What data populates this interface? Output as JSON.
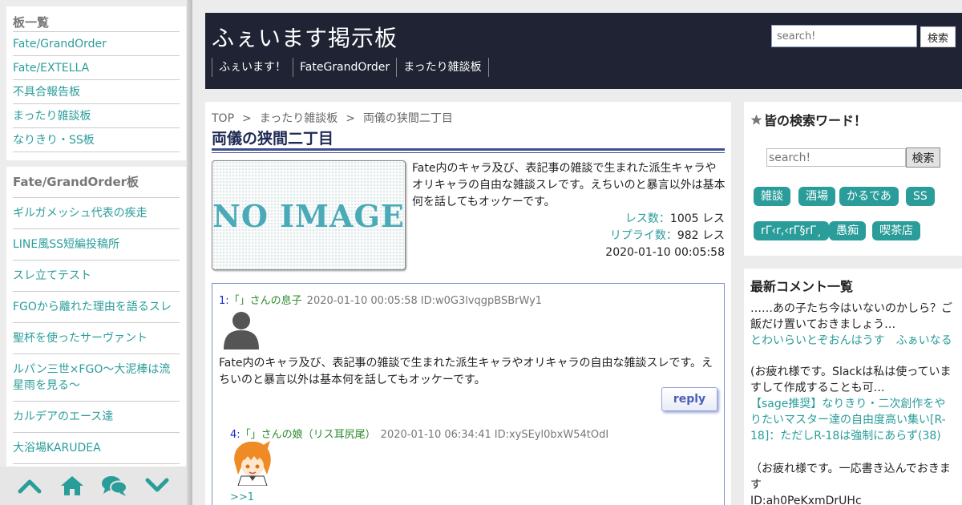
{
  "left_sidebar": {
    "boards_title": "板一覧",
    "boards": [
      "Fate/GrandOrder",
      "Fate/EXTELLA",
      "不具合報告板",
      "まったり雑談板",
      "なりきり・SS板"
    ],
    "fgo_title": "Fate/GrandOrder板",
    "fgo_threads": [
      "ギルガメッシュ代表の疾走",
      "LINE風SS短編投稿所",
      "スレ立てテスト",
      "FGOから離れた理由を語るスレ",
      "聖杯を使ったサーヴァント",
      "ルパン三世×FGO～大泥棒は流星雨を見る～",
      "カルデアのエース達",
      "大浴場KARUDEA"
    ]
  },
  "bottom_nav": {
    "icons": [
      "chevron-up-icon",
      "home-icon",
      "chat-icon",
      "chevron-down-icon"
    ],
    "color": "#2a9d9a"
  },
  "header": {
    "title": "ふぇいます掲示板",
    "search_placeholder": "search!",
    "search_button": "検索",
    "nav": [
      "ふぇいます！",
      "FateGrandOrder",
      "まったり雑談板"
    ]
  },
  "breadcrumb": [
    "TOP",
    ">",
    "まったり雑談板",
    ">",
    "両儀の狭間二丁目"
  ],
  "thread": {
    "title": "両儀の狭間二丁目",
    "no_image_text": "NO IMAGE",
    "description": "Fate内のキャラ及び、表記事の雑談で生まれた派生キャラやオリキャラの自由な雑談スレです。えちいのと暴言以外は基本何を話してもオッケーです。",
    "res_label": "レス数：",
    "res_value": "1005 レス",
    "reply_label": "リプライ数：",
    "reply_value": "982 レス",
    "date": "2020-01-10 00:05:58"
  },
  "posts": [
    {
      "num": "1:",
      "name": "「」さんの息子",
      "date": "2020-01-10 00:05:58",
      "id": "ID:w0G3lvqgpBSBrWy1",
      "body": "Fate内のキャラ及び、表記事の雑談で生まれた派生キャラやオリキャラの自由な雑談スレです。えちいのと暴言以外は基本何を話してもオッケーです。",
      "reply_label": "reply"
    },
    {
      "num": "4:",
      "name": "「」さんの娘（リス耳尻尾）",
      "date": "2020-01-10 06:34:41",
      "id": "ID:xySEyl0bxW54tOdI",
      "anchor": ">>1"
    }
  ],
  "right_sidebar": {
    "search_title": "皆の検索ワード！",
    "search_placeholder": "search!",
    "search_button": "検索",
    "tags": [
      "雑談",
      "酒場",
      "かるであ",
      "SS",
      "rΓ‹r,‹rΓ§rΓ¸",
      "愚痴",
      "喫茶店"
    ],
    "comments_title": "最新コメント一覧",
    "comments": [
      {
        "text": "……あの子たち今はいないのかしら？ご飯だけ置いておきましょう…",
        "link": "とわいらいとぞおんはうす　ふぁいなる"
      },
      {
        "text": "(お疲れ様です。Slackは私は使っていますして作成することも可…",
        "link": "【sage推奨】なりきり・二次創作をやりたいマスター達の自由度高い集い[R-18]：ただしR-18は強制にあらず(38)"
      },
      {
        "text": "（お疲れ様です。一応書き込んでおきます",
        "link": "ID:ah0PeKxmDrUHc"
      }
    ]
  },
  "colors": {
    "accent": "#2a9d9a",
    "header_bg": "#1f2333",
    "title_navy": "#1f2a55",
    "post_num_blue": "#1b2cc8",
    "post_name_green": "#2a8a2a"
  }
}
